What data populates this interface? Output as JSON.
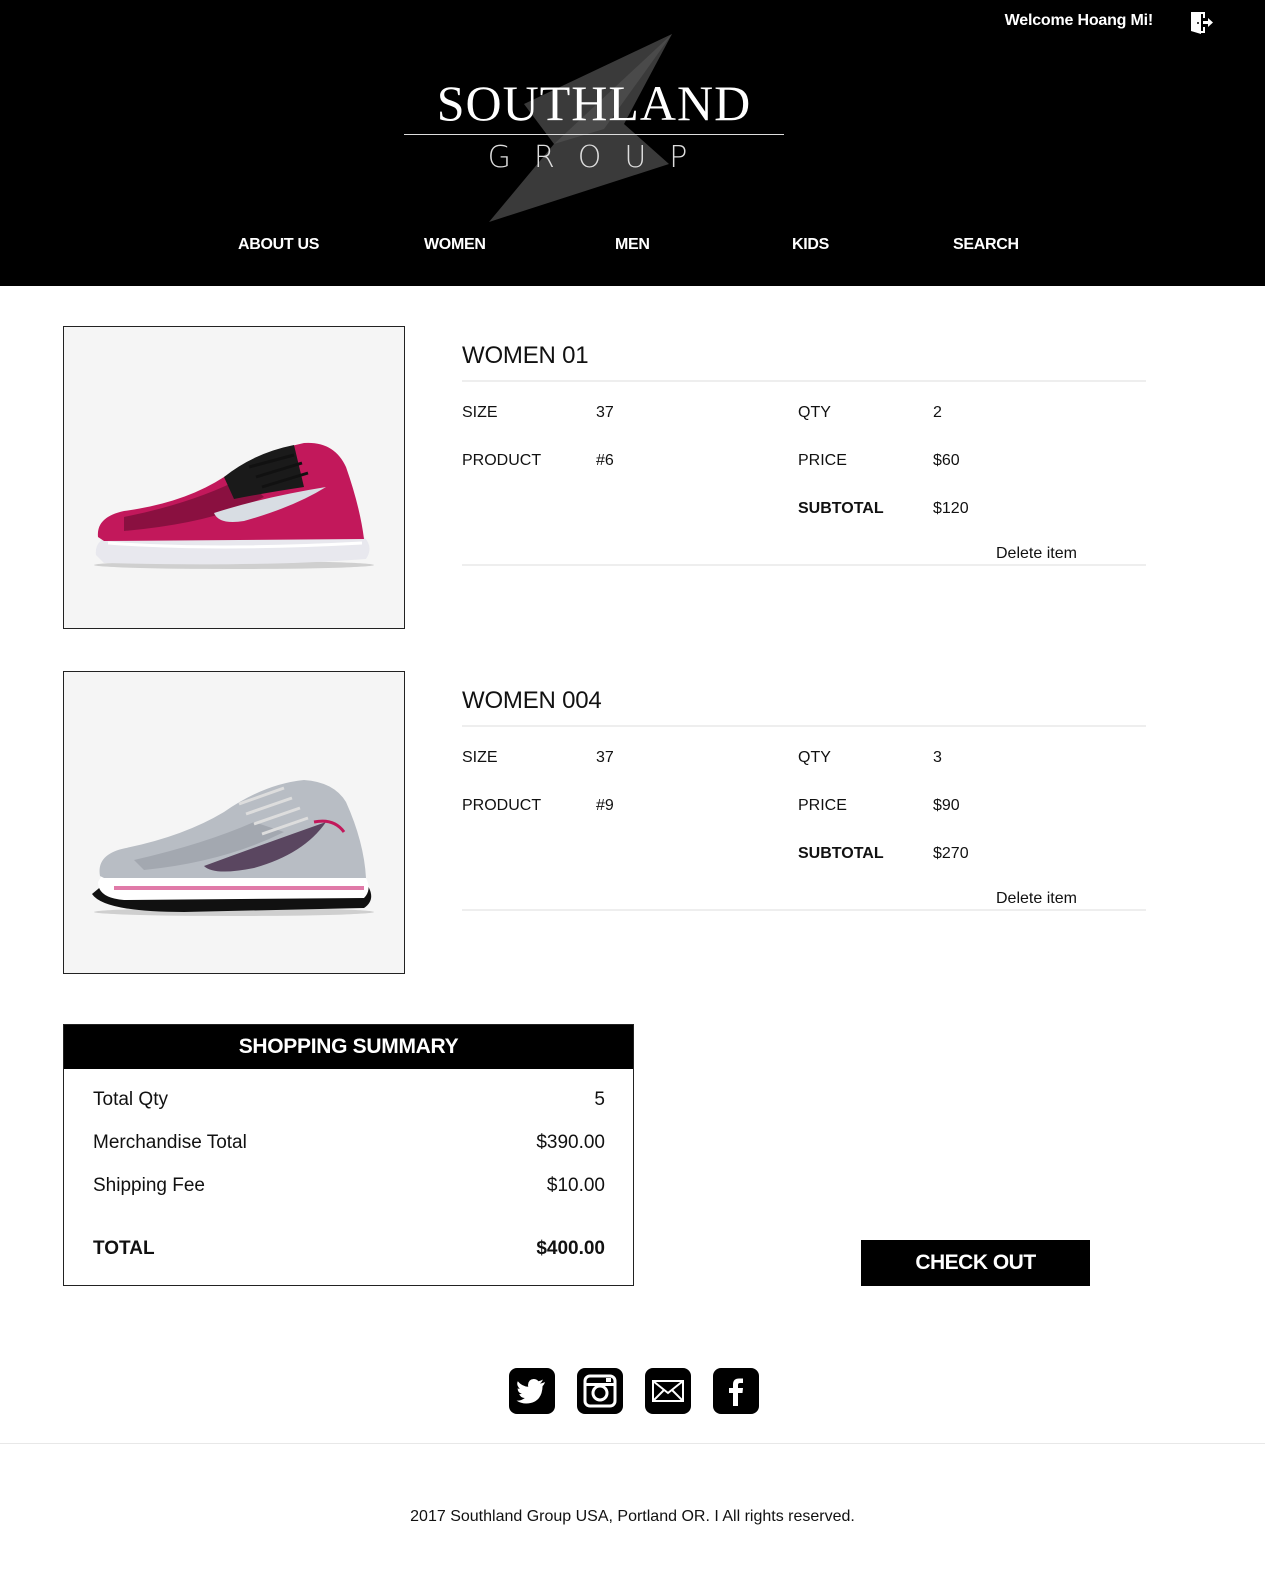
{
  "header": {
    "welcome": "Welcome Hoang Mi!",
    "logout_icon": "logout-icon",
    "logo": {
      "main": "SOUTHLAND",
      "sub": "GROUP"
    },
    "nav": [
      "ABOUT US",
      "WOMEN",
      "MEN",
      "KIDS",
      "SEARCH"
    ]
  },
  "cart": {
    "labels": {
      "size": "SIZE",
      "product": "PRODUCT",
      "qty": "QTY",
      "price": "PRICE",
      "subtotal": "SUBTOTAL",
      "delete": "Delete item"
    },
    "items": [
      {
        "name": "WOMEN 01",
        "size": "37",
        "product": "#6",
        "qty": "2",
        "price": "$60",
        "subtotal": "$120",
        "image": "pink-running-shoe"
      },
      {
        "name": "WOMEN 004",
        "size": "37",
        "product": "#9",
        "qty": "3",
        "price": "$90",
        "subtotal": "$270",
        "image": "grey-running-shoe"
      }
    ]
  },
  "summary": {
    "title": "SHOPPING SUMMARY",
    "rows": [
      {
        "label": "Total Qty",
        "value": "5"
      },
      {
        "label": "Merchandise Total",
        "value": "$390.00"
      },
      {
        "label": "Shipping Fee",
        "value": "$10.00"
      }
    ],
    "total": {
      "label": "TOTAL",
      "value": "$400.00"
    }
  },
  "checkout": "CHECK OUT",
  "social": [
    "twitter-icon",
    "instagram-icon",
    "mail-icon",
    "facebook-icon"
  ],
  "footer": "2017 Southland Group USA, Portland OR. I All rights reserved.",
  "colors": {
    "header_bg": "#000000",
    "accent_pink": "#c2185b",
    "text": "#111111"
  }
}
